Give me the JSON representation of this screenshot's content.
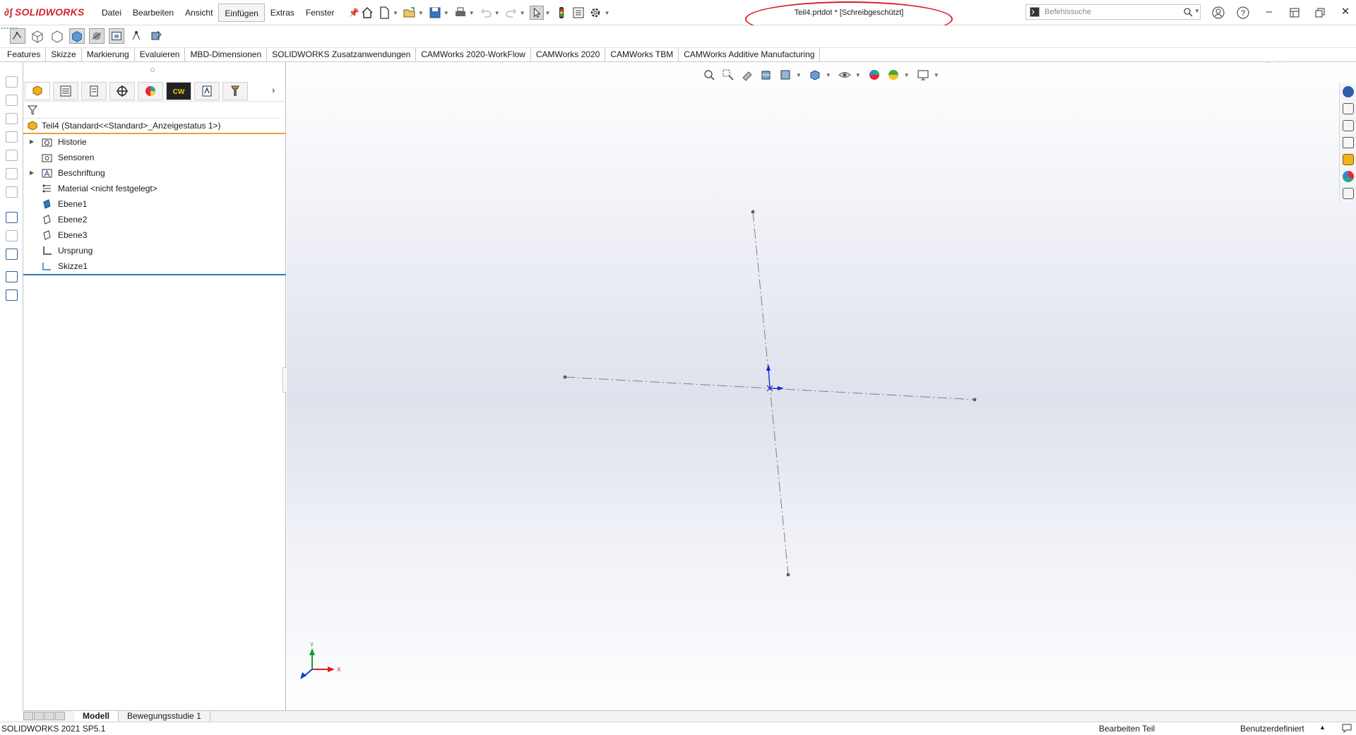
{
  "app": {
    "logo_text": "SOLIDWORKS",
    "document_title": "Teil4.prtdot * [Schreibgeschützt]",
    "brand_color": "#d0262c",
    "highlight_color": "#d81f26"
  },
  "menu": [
    "Datei",
    "Bearbeiten",
    "Ansicht",
    "Einfügen",
    "Extras",
    "Fenster"
  ],
  "menu_active": "Einfügen",
  "search": {
    "placeholder": "Befehlssuche"
  },
  "command_tabs": [
    "Features",
    "Skizze",
    "Markierung",
    "Evaluieren",
    "MBD-Dimensionen",
    "SOLIDWORKS Zusatzanwendungen",
    "CAMWorks 2020-WorkFlow",
    "CAMWorks 2020",
    "CAMWorks TBM",
    "CAMWorks Additive Manufacturing"
  ],
  "feature_tree": {
    "root": "Teil4  (Standard<<Standard>_Anzeigestatus 1>)",
    "items": [
      {
        "label": "Historie",
        "expandable": true,
        "icon": "history-folder-icon"
      },
      {
        "label": "Sensoren",
        "expandable": false,
        "icon": "sensor-folder-icon"
      },
      {
        "label": "Beschriftung",
        "expandable": true,
        "icon": "annotations-icon"
      },
      {
        "label": "Material <nicht festgelegt>",
        "expandable": false,
        "icon": "material-icon"
      },
      {
        "label": "Ebene1",
        "expandable": false,
        "icon": "plane-icon"
      },
      {
        "label": "Ebene2",
        "expandable": false,
        "icon": "plane-icon"
      },
      {
        "label": "Ebene3",
        "expandable": false,
        "icon": "plane-icon"
      },
      {
        "label": "Ursprung",
        "expandable": false,
        "icon": "origin-icon"
      },
      {
        "label": "Skizze1",
        "expandable": false,
        "icon": "sketch-icon"
      }
    ]
  },
  "bottom_tabs": [
    "Modell",
    "Bewegungsstudie 1"
  ],
  "bottom_tab_active": "Modell",
  "status": {
    "version": "SOLIDWORKS 2021 SP5.1",
    "mode": "Bearbeiten Teil",
    "units": "Benutzerdefiniert"
  },
  "triad": {
    "x": "X",
    "y": "Y"
  }
}
